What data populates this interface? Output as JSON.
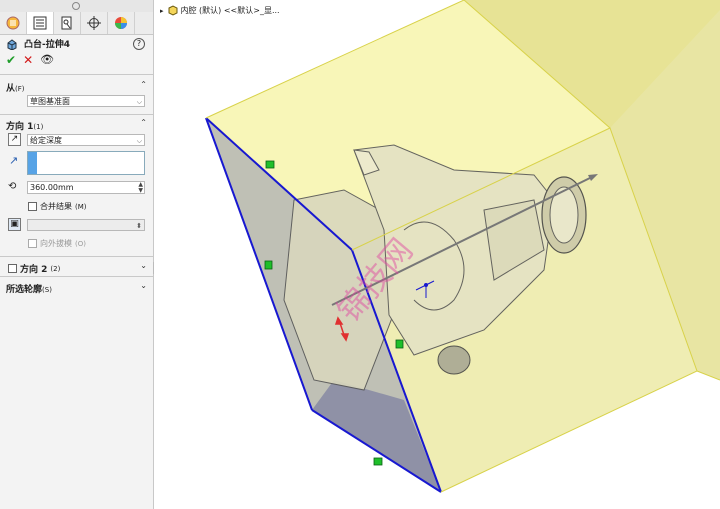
{
  "feature": {
    "title": "凸台-拉伸4",
    "icon": "extrude-icon"
  },
  "actions": {
    "ok": "✔",
    "cancel": "✕",
    "preview": "👁"
  },
  "from": {
    "header": "从",
    "header_suffix": "(F)",
    "value": "草图基准面"
  },
  "direction1": {
    "header": "方向 1",
    "header_suffix": "(1)",
    "end_condition": "给定深度",
    "depth": "360.00mm",
    "merge_label": "合并结果",
    "merge_suffix": "(M)",
    "merge_checked": false,
    "draft_label": "向外拔模",
    "draft_suffix": "(O)",
    "draft_checked": false
  },
  "direction2": {
    "label": "方向 2",
    "suffix": "(2)",
    "checked": false
  },
  "contours": {
    "label": "所选轮廓",
    "suffix": "(S)"
  },
  "breadcrumb": {
    "text": "内腔 (默认) <<默认>_显..."
  },
  "watermark": "锦技网",
  "colors": {
    "preview_fill": "#f3f07a",
    "edge_blue": "#1818d0",
    "handle_green": "#1fbf2a",
    "watermark": "#e040a0"
  }
}
